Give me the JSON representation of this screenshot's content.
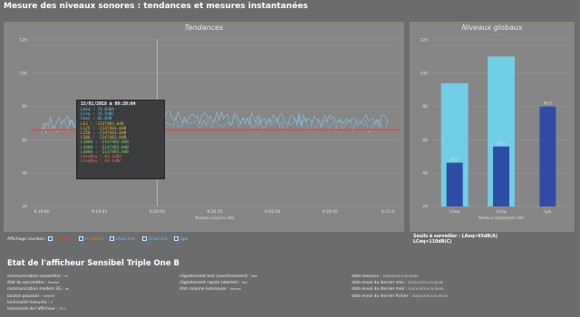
{
  "app_title": "Mesure des niveaux sonores : tendances et mesures instantanées",
  "trends": {
    "title": "Tendances",
    "y_ticks": [
      "120",
      "100",
      "80",
      "60",
      "40",
      "20"
    ],
    "x_ticks": [
      "9:19:00",
      "9:19:45",
      "9:20:00",
      "9:20:15",
      "9:20:30",
      "9:20:45",
      "9:21:0"
    ],
    "x_label": "Niveaux moyens (dB)",
    "tooltip": {
      "title": "15/01/2018 à 09:20:04",
      "lines": [
        {
          "text": "LAeq : 74.0dBA",
          "color": "#62c3ea"
        },
        {
          "text": "LCeq : 76.5dBC",
          "color": "#62c3ea"
        },
        {
          "text": "Cmax : 66.0dB",
          "color": "#62c3ea"
        },
        {
          "text": "L63 : -2147483.0dB",
          "color": "#e8c43b"
        },
        {
          "text": "L125 : -2147483.0dB",
          "color": "#e8c43b"
        },
        {
          "text": "L250 : -2147483.0dB",
          "color": "#e8c43b"
        },
        {
          "text": "L500 : -2147483.0dB",
          "color": "#e8c43b"
        },
        {
          "text": "L1000 : -2147483.0dB",
          "color": "#86d37a"
        },
        {
          "text": "L2000 : -2147483.0dB",
          "color": "#86d37a"
        },
        {
          "text": "L4000 : -2147483.0dB",
          "color": "#86d37a"
        },
        {
          "text": "LAeqMoy : 66.1dBA",
          "color": "#ff6e4a"
        },
        {
          "text": "LCeqMoy : 69.1dBC",
          "color": "#ff6e4a"
        }
      ]
    }
  },
  "global": {
    "title": "Niveaux globaux",
    "y_ticks": [
      "120",
      "100",
      "80",
      "60",
      "40",
      "20"
    ],
    "categories": [
      "LAeq",
      "LCeq",
      "Lpk"
    ],
    "x_label": "Niveaux instantanés (dB)",
    "bar_labels": [
      "46.3",
      "56.0",
      "80.0"
    ]
  },
  "chart_data": [
    {
      "type": "line",
      "title": "Tendances",
      "xlabel": "Niveaux moyens (dB)",
      "x": [
        "9:19:00",
        "9:19:45",
        "9:20:00",
        "9:20:15",
        "9:20:30",
        "9:20:45",
        "9:21:0"
      ],
      "ylim": [
        20,
        120
      ],
      "grid": true,
      "series": [
        {
          "name": "LAeq",
          "values": [
            67,
            69,
            72,
            71,
            70,
            69,
            68
          ],
          "color": "#6fc8ec"
        },
        {
          "name": "LCeq",
          "values": [
            70,
            72,
            74,
            73,
            72,
            72,
            71
          ],
          "color": "#8fd6f0"
        },
        {
          "name": "LAeqMoy",
          "values": [
            66,
            66,
            66,
            66,
            66,
            66,
            66
          ],
          "color": "#ff3a2a"
        }
      ]
    },
    {
      "type": "bar",
      "title": "Niveaux globaux",
      "xlabel": "Niveaux instantanés (dB)",
      "categories": [
        "LAeq",
        "LCeq",
        "Lpk"
      ],
      "ylim": [
        20,
        120
      ],
      "series": [
        {
          "values": [
            94,
            110,
            0
          ],
          "color": "#70cde6"
        },
        {
          "values": [
            46.3,
            56.0,
            80.0
          ],
          "color": "#2f4da6"
        }
      ]
    }
  ],
  "legend": {
    "label": "Affichage courbes :",
    "items": [
      "LAeqMoy",
      "LCeqMoy",
      "LAeq inst.",
      "LCeq inst.",
      "Lpk"
    ],
    "colors": [
      "#e9452d",
      "#e87a2a",
      "#6ac6ea",
      "#6ac6ea",
      "#8ad0ee"
    ]
  },
  "threshold": {
    "line1": "Seuils à surveiller : LAeq=95dB(A)",
    "line2": "LCeq=110dB(C)"
  },
  "status": {
    "title": "Etat de l'afficheur Sensibel Triple One B",
    "col1": [
      {
        "label": "communication sonomètre :",
        "value": "ok"
      },
      {
        "label": "état du sonomètre :",
        "value": "Normal"
      },
      {
        "label": "communication modem 3G :",
        "value": "ok"
      },
      {
        "label": "bouton poussoir :",
        "value": "relâché"
      },
      {
        "label": "luminosité mesurée :",
        "value": "3"
      },
      {
        "label": "luminosité de l'afficheur :",
        "value": "15.1"
      }
    ],
    "col2": [
      {
        "label": "clignotement lent (avertissement) :",
        "value": "Non"
      },
      {
        "label": "clignotement rapide (alarme) :",
        "value": "Non"
      },
      {
        "label": "état colonne lumineuse :",
        "value": "Normal"
      }
    ],
    "col3": [
      {
        "label": "date mesures :",
        "value": "15/01/2018 à 09:20:04"
      },
      {
        "label": "date envoi du dernier sms :",
        "value": "01/01/1970 à 01:00:00"
      },
      {
        "label": "date envoi du dernier mail :",
        "value": "01/01/1970 à 01:00:00"
      },
      {
        "label": "date envoi du dernier fichier :",
        "value": "01/01/1970 à 01:00:00"
      }
    ]
  }
}
